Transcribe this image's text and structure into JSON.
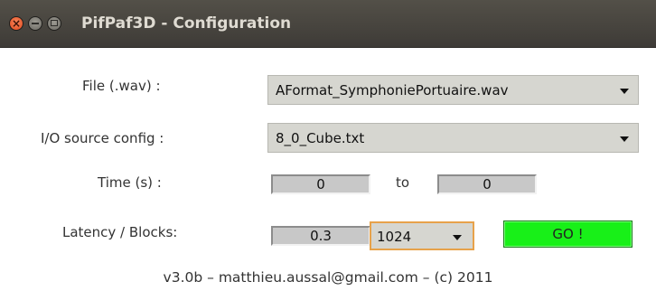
{
  "window": {
    "title": "PifPaf3D - Configuration",
    "controls": {
      "close_icon": "close-icon",
      "minimize_icon": "minimize-icon",
      "maximize_icon": "maximize-icon"
    }
  },
  "form": {
    "file_label": "File (.wav) :",
    "file_value": "AFormat_SymphoniePortuaire.wav",
    "io_label": "I/O source config :",
    "io_value": "8_0_Cube.txt",
    "time_label": "Time (s) :",
    "time_from": "0",
    "time_to_label": "to",
    "time_to": "0",
    "latency_label": "Latency / Blocks:",
    "latency_value": "0.3",
    "blocks_value": "1024",
    "go_label": "GO !"
  },
  "footer": {
    "text": "v3.0b – matthieu.aussal@gmail.com – (c) 2011"
  },
  "colors": {
    "titlebar": "#3e3b37",
    "go_button": "#18f018",
    "focus_border": "#e7a24a",
    "combo_bg": "#d6d6d0"
  }
}
